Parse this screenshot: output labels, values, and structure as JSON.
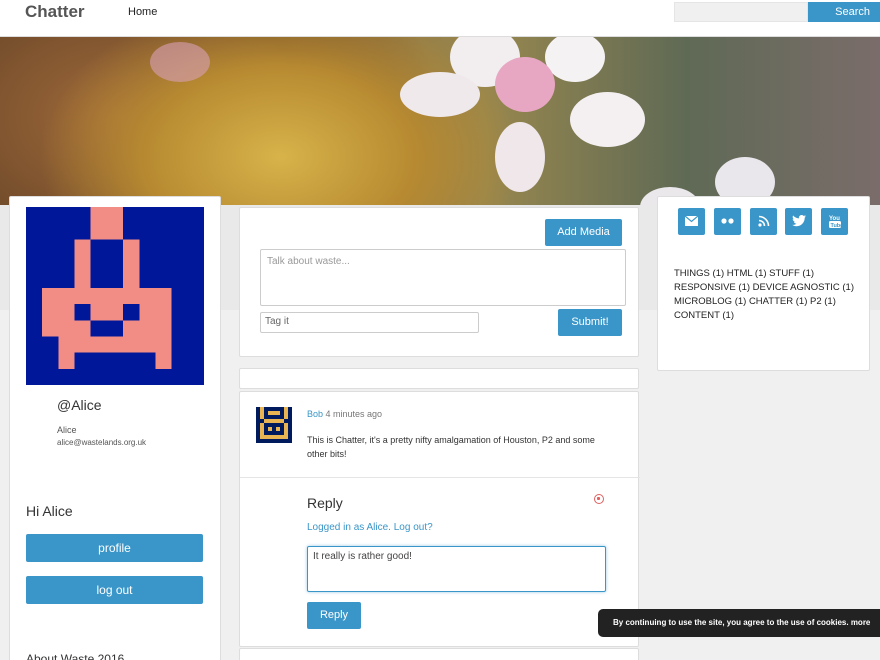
{
  "header": {
    "brand": "Chatter",
    "nav_home": "Home",
    "search_placeholder": "",
    "search_button": "Search"
  },
  "profile": {
    "handle": "@Alice",
    "name": "Alice",
    "email": "alice@wastelands.org.uk",
    "greeting": "Hi Alice",
    "profile_button": "profile",
    "logout_button": "log out",
    "about_title": "About Waste 2016"
  },
  "composer": {
    "add_media": "Add Media",
    "talk_placeholder": "Talk about waste...",
    "tag_placeholder": "Tag it",
    "submit": "Submit!"
  },
  "post": {
    "author": "Bob",
    "time": "4 minutes ago",
    "body": "This is Chatter, it's a pretty nifty amalgamation of Houston, P2 and some other bits!",
    "reply_title": "Reply",
    "logged_in": "Logged in as Alice. Log out?",
    "reply_value": "It really is rather good!",
    "reply_button": "Reply"
  },
  "social": {
    "icons": [
      "mail-icon",
      "flickr-icon",
      "rss-icon",
      "twitter-icon",
      "youtube-icon"
    ],
    "accent": "#3a96c8"
  },
  "tags_text": "THINGS (1) HTML (1) STUFF (1) RESPONSIVE (1) DEVICE AGNOSTIC (1) MICROBLOG (1) CHATTER (1) P2 (1) CONTENT (1)",
  "cookie": {
    "text": "By continuing to use the site, you agree to the use of cookies. more"
  },
  "colors": {
    "accent": "#3a96c8",
    "avatar_bg": "#001799",
    "avatar_fg": "#f28d86"
  }
}
